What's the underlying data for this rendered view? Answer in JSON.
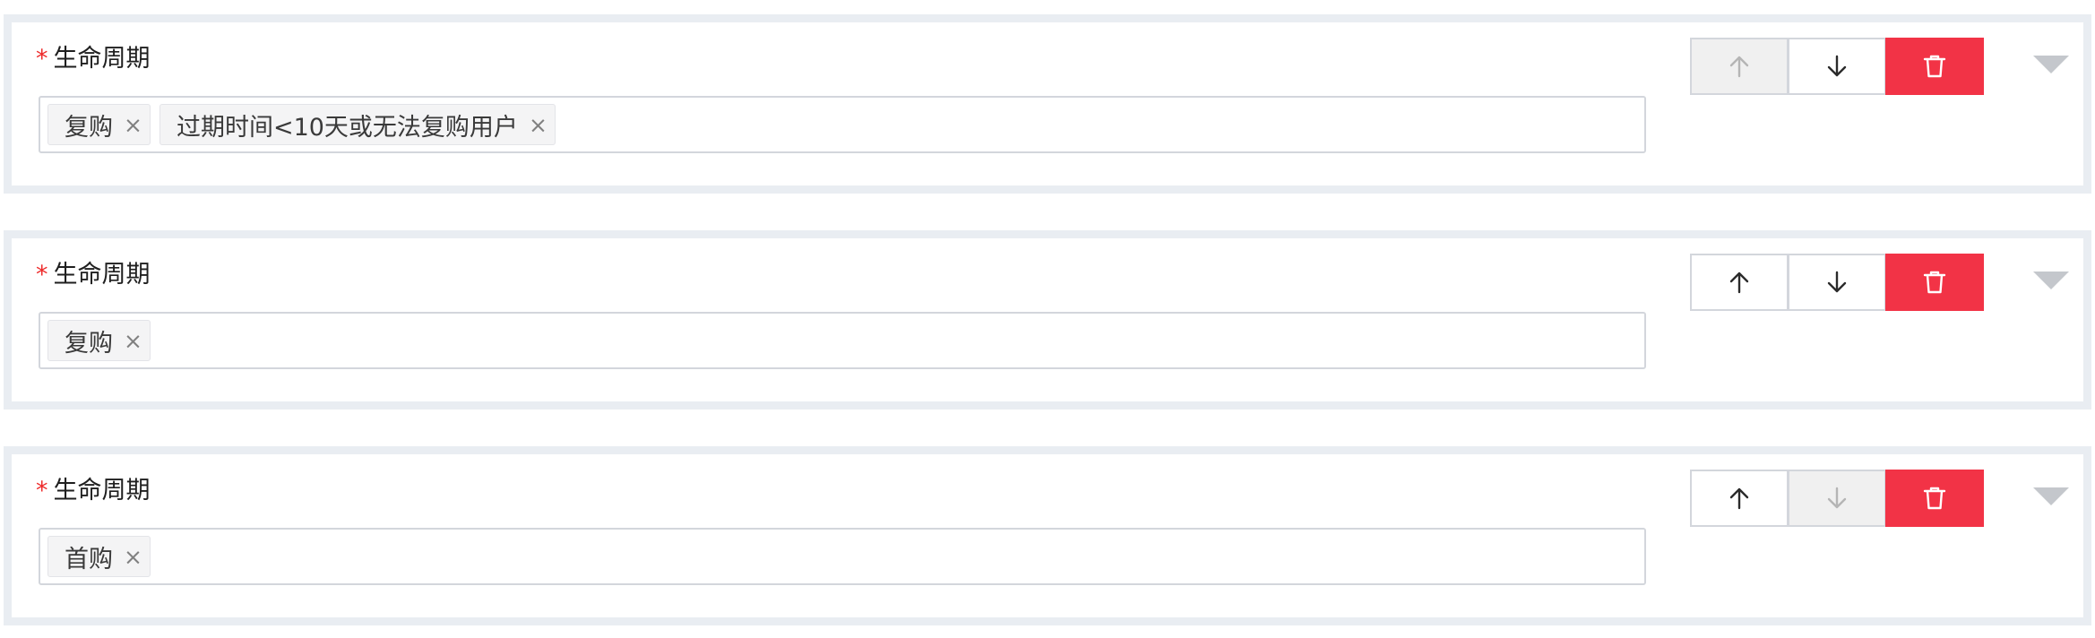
{
  "colors": {
    "card_border": "#e9edf2",
    "required_star": "#ee2b2b",
    "delete_button": "#f23346",
    "disabled_icon": "#b5b5b5",
    "enabled_icon": "#2b2b2b"
  },
  "icons": {
    "up": "arrow-up-icon",
    "down": "arrow-down-icon",
    "delete": "trash-icon",
    "collapse": "caret-down-icon",
    "tag_close": "close-icon"
  },
  "cards": [
    {
      "required_mark": "*",
      "label": "生命周期",
      "tags": [
        {
          "text": "复购",
          "close": "×"
        },
        {
          "text": "过期时间<10天或无法复购用户",
          "close": "×"
        }
      ],
      "up_disabled": true,
      "down_disabled": false
    },
    {
      "required_mark": "*",
      "label": "生命周期",
      "tags": [
        {
          "text": "复购",
          "close": "×"
        }
      ],
      "up_disabled": false,
      "down_disabled": false
    },
    {
      "required_mark": "*",
      "label": "生命周期",
      "tags": [
        {
          "text": "首购",
          "close": "×"
        }
      ],
      "up_disabled": false,
      "down_disabled": true
    }
  ]
}
